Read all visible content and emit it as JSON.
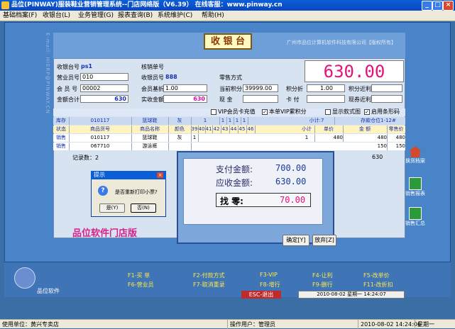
{
  "window": {
    "title": "品位(PINWAY)服装鞋业营销管理系统--门店网络版（V6.39）  在线客服：www.pinway.cn"
  },
  "menu": [
    "基础档案(F)",
    "收银台(L)",
    "业务管理(G)",
    "报表查询(B)",
    "系统维护(C)",
    "帮助(H)"
  ],
  "header": {
    "logo": "收 银 台",
    "company": "广州市品位计算机软件科技有限公司【版权所有】",
    "side_text": "E-mail: HIERP@PINWAY.CN"
  },
  "form": {
    "register_label": "收银台号",
    "register_value": "ps1",
    "verify_label": "核销单号",
    "clerk_label": "营业员号",
    "clerk_value": "010",
    "receipt_label": "收银员号",
    "receipt_value": "888",
    "retail_label": "零售方式",
    "member_label": "会 员 号",
    "member_value": "00002",
    "member_disc_label": "会员基折",
    "member_disc_value": "1.00",
    "points_label": "当前积分",
    "points_value": "39999.00",
    "points_disc_label": "积分折",
    "points_disc_value": "1.00",
    "points_rate_label": "积分近利",
    "total_label": "金额合计",
    "total_value": "630",
    "actual_label": "实收金额",
    "actual_value": "630",
    "cash_label": "现  金",
    "card_label": "卡  付",
    "settle_label": "现券近利",
    "big_total": "630.00"
  },
  "options": {
    "vip_recharge": "VIP会员卡充值",
    "vip_points": "本单VIP累积分",
    "show_style": "显示款式图",
    "barcode": "启用条形码"
  },
  "stock_row": {
    "label": "库存",
    "code": "010117",
    "name": "篮球鞋",
    "color": "灰",
    "sizes": [
      "1",
      "1",
      "1",
      "1",
      "1"
    ],
    "subtotal": "小计:7",
    "location": "存款仓位1-12#"
  },
  "grid": {
    "headers": [
      "状态",
      "商品货号",
      "商品名称",
      "颜色",
      "39",
      "40",
      "41",
      "42",
      "43",
      "44",
      "45",
      "46",
      "小计",
      "单价",
      "金  额",
      "零售价"
    ],
    "rows": [
      {
        "status": "销售",
        "code": "010117",
        "name": "篮球鞋",
        "color": "灰",
        "qty": "1",
        "subtotal": "1",
        "price": "480",
        "amount": "480",
        "retail": "480"
      },
      {
        "status": "销售",
        "code": "067710",
        "name": "游泳裤",
        "color": "",
        "qty": "",
        "subtotal": "",
        "price": "",
        "amount": "150",
        "retail": "150"
      }
    ],
    "record_count": "记录数：2",
    "footer_amount": "630"
  },
  "payment": {
    "pay_label": "支付金额:",
    "pay_value": "700.00",
    "due_label": "应收金额:",
    "due_value": "630.00",
    "change_label": "找    零:",
    "change_value": "70.00",
    "ok": "确定[Y]",
    "cancel": "放弃[Z]"
  },
  "prompt": {
    "title": "提示",
    "message": "是否重新打印小票?",
    "yes": "是(Y)",
    "no": "否(N)"
  },
  "brand_text": "品位软件门店版",
  "side_icons": [
    "换货档案",
    "销售报表",
    "销售汇总"
  ],
  "function_keys": [
    "F1-买  单",
    "F2-付款方式",
    "F3-VIP",
    "F4-让利",
    "F5-改单价",
    "F6-营业员",
    "F7-取消重录",
    "F8-增行",
    "F9-删行",
    "F11-改折扣"
  ],
  "esc": "ESC-退出",
  "clock": "2010-08-02 星期一 14:24:07",
  "status": {
    "unit": "使用单位：黄兴专卖店",
    "user": "操作用户：管理员",
    "datetime": "2010-08-02 14:24:06",
    "weekday": "星期一"
  },
  "colors": {
    "accent_pink": "#e0147a",
    "title_blue": "#0a5fd8",
    "frame_blue": "#4a84c8"
  }
}
